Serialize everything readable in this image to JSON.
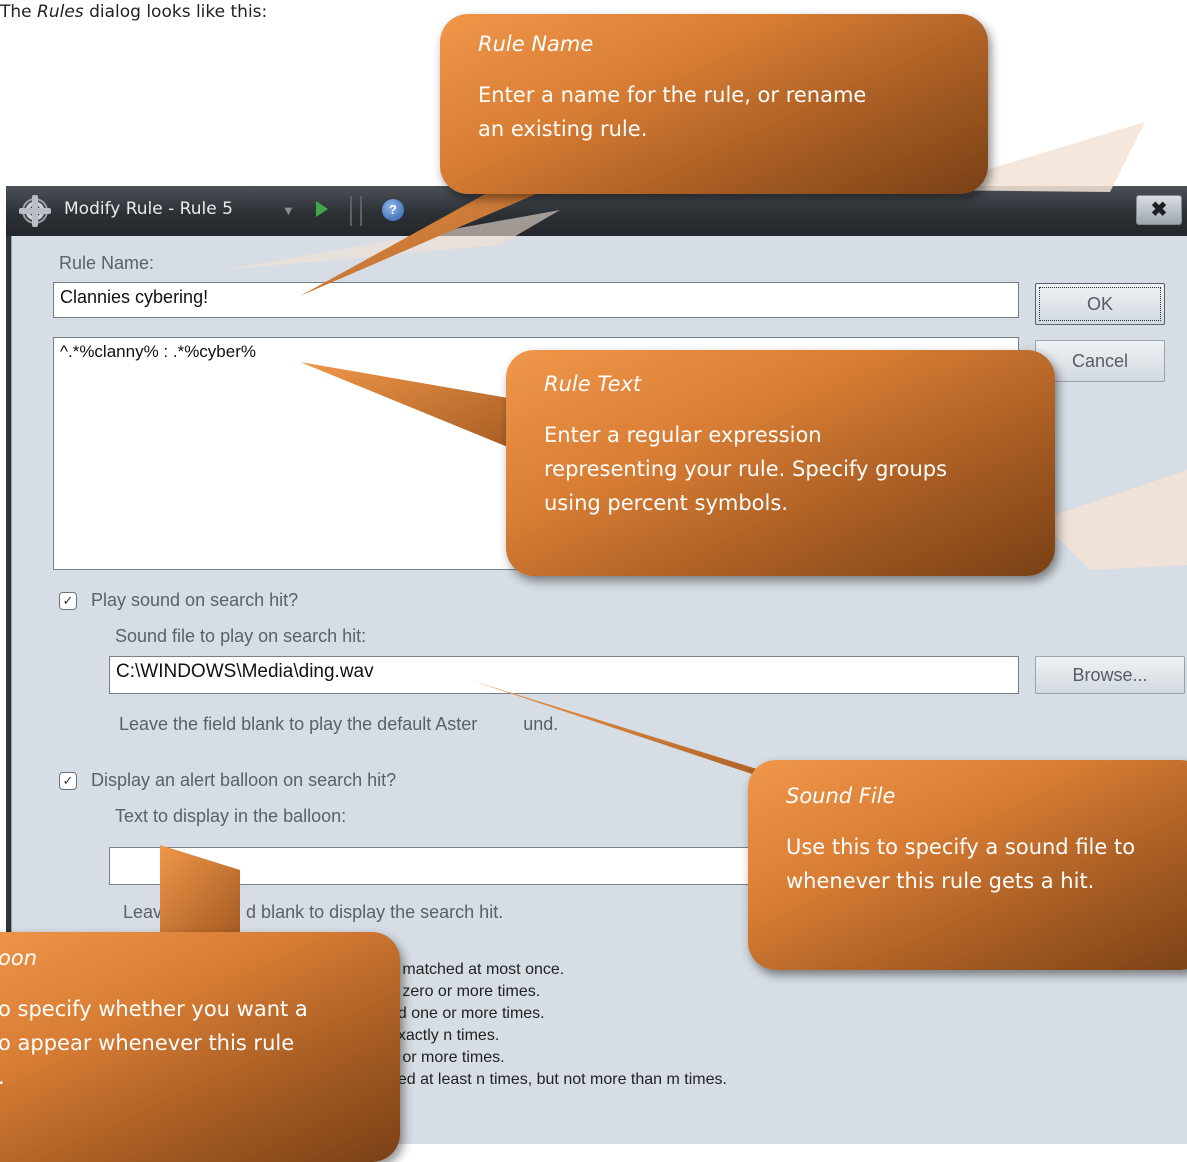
{
  "intro": {
    "prefix": "The ",
    "emph": "Rules",
    "suffix": " dialog looks like this:"
  },
  "dialog": {
    "title": "Modify Rule - Rule 5",
    "close_label": "✖",
    "rule_name_label": "Rule Name:",
    "rule_name_value": "Clannies cybering!",
    "rule_text_value": "^.*%clanny% : .*%cyber%",
    "ok_label": "OK",
    "cancel_label": "Cancel",
    "play_sound_label": "Play sound on search hit?",
    "play_sound_checked": true,
    "sound_file_label": "Sound file to play on search hit:",
    "sound_file_value": "C:\\WINDOWS\\Media\\ding.wav",
    "browse_label": "Browse...",
    "sound_hint": "Leave the field blank to play the default Aster",
    "sound_hint_tail": "und.",
    "balloon_label": "Display an alert balloon on search hit?",
    "balloon_checked": true,
    "balloon_text_label": "Text to display in the balloon:",
    "balloon_text_value": "",
    "balloon_hint_head": "Leav",
    "balloon_hint_tail": "d blank to display the search hit.",
    "help_lines": [
      "d matched at most once.",
      "d zero or more times.",
      "ed one or more times.",
      "exactly n times.",
      "n or more times.",
      "ned at least n times, but not more than m times."
    ]
  },
  "callouts": {
    "rule_name": {
      "title": "Rule Name",
      "body": [
        "Enter a name for the rule, or rename",
        "an existing rule."
      ]
    },
    "rule_text": {
      "title": "Rule Text",
      "body": [
        "Enter a regular expression",
        "representing your rule. Specify groups",
        "using percent symbols."
      ]
    },
    "sound_file": {
      "title": "Sound File",
      "body": [
        "Use this to specify a sound file to",
        "whenever this rule gets a hit."
      ]
    },
    "balloon": {
      "title": "oon",
      "body": [
        "o specify whether you want a",
        "o appear whenever this rule",
        "."
      ]
    }
  },
  "colors": {
    "callout_top": "#f0974a",
    "callout_bottom": "#7a4016",
    "dialog_bg": "#d6dde4",
    "titlebar": "#2c3136"
  }
}
